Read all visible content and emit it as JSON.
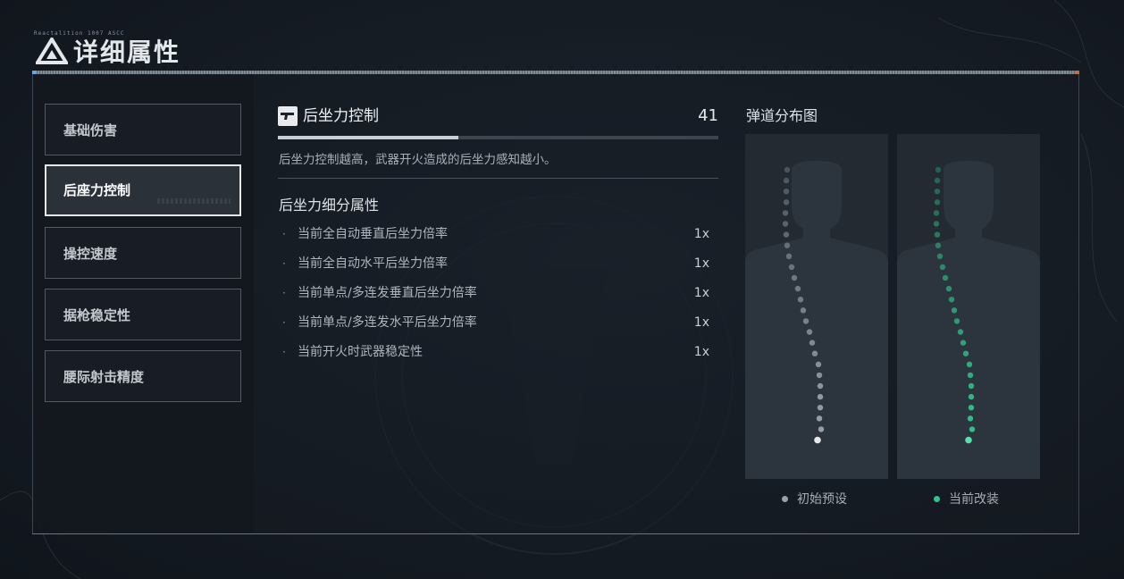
{
  "header": {
    "title": "详细属性",
    "small_text": "Reactalition 1007 ASCC",
    "logo_icon": "triangle-logo-icon"
  },
  "sidebar": {
    "items": [
      {
        "label": "基础伤害",
        "active": false
      },
      {
        "label": "后座力控制",
        "active": true
      },
      {
        "label": "操控速度",
        "active": false
      },
      {
        "label": "据枪稳定性",
        "active": false
      },
      {
        "label": "腰际射击精度",
        "active": false
      }
    ]
  },
  "attribute": {
    "icon": "pistol-icon",
    "name": "后坐力控制",
    "value": "41",
    "progress": 0.41,
    "description": "后坐力控制越高，武器开火造成的后坐力感知越小。"
  },
  "sub_attributes": {
    "title": "后坐力细分属性",
    "rows": [
      {
        "label": "当前全自动垂直后坐力倍率",
        "value": "1x"
      },
      {
        "label": "当前全自动水平后坐力倍率",
        "value": "1x"
      },
      {
        "label": "当前单点/多连发垂直后坐力倍率",
        "value": "1x"
      },
      {
        "label": "当前单点/多连发水平后坐力倍率",
        "value": "1x"
      },
      {
        "label": "当前开火时武器稳定性",
        "value": "1x"
      }
    ]
  },
  "ballistics": {
    "title": "弹道分布图",
    "legend": [
      {
        "label": "初始预设",
        "color": "#9aa2aa"
      },
      {
        "label": "当前改装",
        "color": "#2fc58a"
      }
    ]
  },
  "colors": {
    "accent_green": "#2fc58a",
    "default_gray": "#9aa2aa",
    "active_border": "#e4e6e8"
  }
}
